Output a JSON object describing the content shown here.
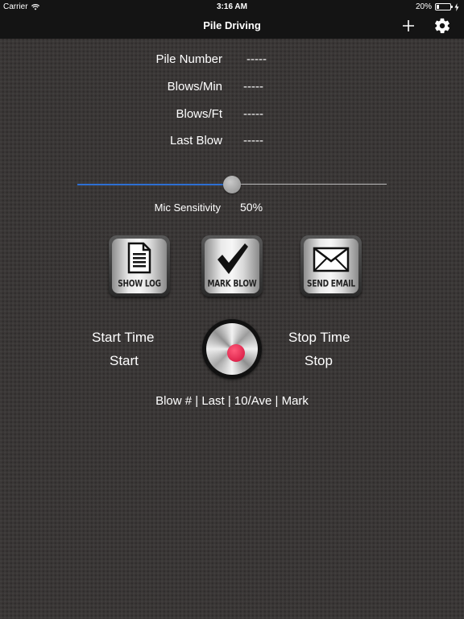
{
  "status_bar": {
    "carrier": "Carrier",
    "time": "3:16 AM",
    "battery_percent_text": "20%",
    "battery_level": 0.2
  },
  "nav": {
    "title": "Pile Driving",
    "add_icon": "plus-icon",
    "settings_icon": "gear-icon"
  },
  "info": {
    "pile_number": {
      "label": "Pile Number",
      "value": "-----"
    },
    "blows_min": {
      "label": "Blows/Min",
      "value": "-----"
    },
    "blows_ft": {
      "label": "Blows/Ft",
      "value": "-----"
    },
    "last_blow": {
      "label": "Last Blow",
      "value": "-----"
    }
  },
  "mic": {
    "label": "Mic Sensitivity",
    "value_text": "50%",
    "level": 0.5,
    "accent_color": "#2d6fd3"
  },
  "buttons": {
    "show_log": {
      "label": "SHOW LOG",
      "icon": "document-icon"
    },
    "mark_blow": {
      "label": "MARK BLOW",
      "icon": "checkmark-icon"
    },
    "send_email": {
      "label": "SEND EMAIL",
      "icon": "envelope-icon"
    }
  },
  "timer": {
    "start_title": "Start Time",
    "start_value": "Start",
    "stop_title": "Stop Time",
    "stop_value": "Stop",
    "record_icon": "record-icon",
    "record_color": "#e0173f"
  },
  "blow_table": {
    "header": "Blow # | Last | 10/Ave | Mark"
  }
}
